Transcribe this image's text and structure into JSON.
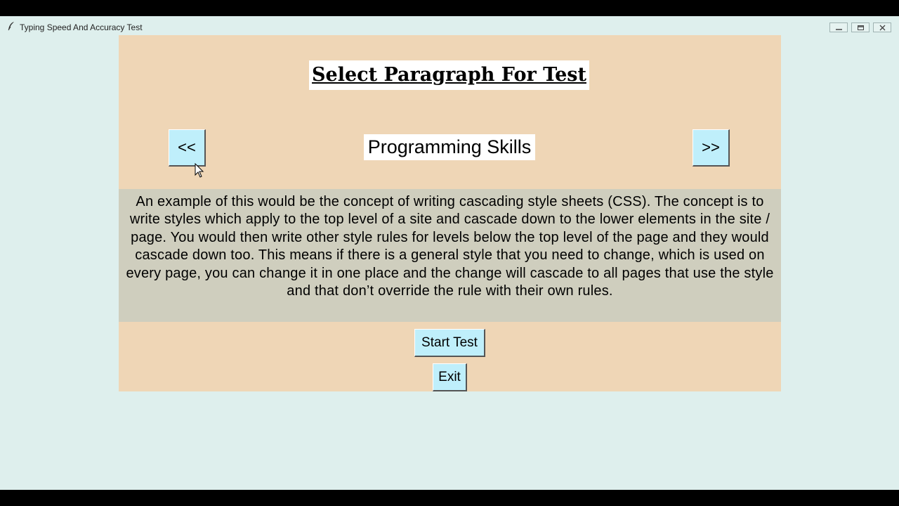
{
  "window": {
    "title": "Typing Speed And Accuracy Test"
  },
  "main": {
    "heading": "Select Paragraph For Test",
    "prev_label": "<<",
    "next_label": ">>",
    "paragraph_title": "Programming Skills",
    "paragraph_text": "An example of this would be the concept of writing cascading style sheets (CSS). The concept is to write styles which apply to the top level of a site and cascade down to the lower elements in the site / page. You would then write other style rules for levels below the top level of the page and they would cascade down too. This means if there is a general style that you need to change, which is used on every page, you can change it in one place and the change will cascade to all pages that use the style and that don’t override the rule with their own rules.",
    "start_label": "Start Test",
    "exit_label": "Exit"
  },
  "colors": {
    "window_bg": "#deefed",
    "panel_bg": "#efd6b6",
    "paragraph_bg": "#cfcebe",
    "button_bg": "#bfeffb"
  },
  "icons": [
    "feather-icon",
    "minimize-icon",
    "maximize-icon",
    "close-icon",
    "mouse-cursor-icon"
  ]
}
